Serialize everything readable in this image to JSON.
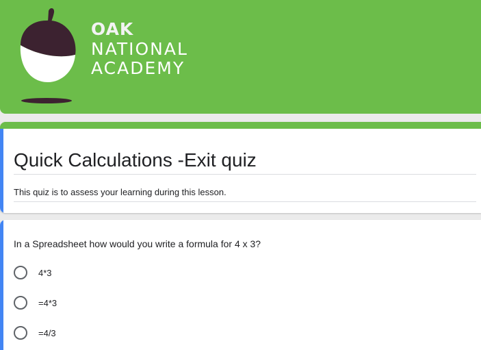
{
  "brand": {
    "line1": "OAK",
    "line2": "NATIONAL",
    "line3": "ACADEMY",
    "logo_icon": "acorn-icon"
  },
  "colors": {
    "header": "#6cbd4a",
    "accent": "#4285f4",
    "card": "#ffffff"
  },
  "form": {
    "title": "Quick Calculations -Exit quiz",
    "description": "This quiz is to assess your learning during this lesson."
  },
  "question": {
    "text": "In a Spreadsheet how would you write a formula for 4 x 3?",
    "options": [
      {
        "label": "4*3"
      },
      {
        "label": "=4*3"
      },
      {
        "label": "=4/3"
      }
    ]
  }
}
